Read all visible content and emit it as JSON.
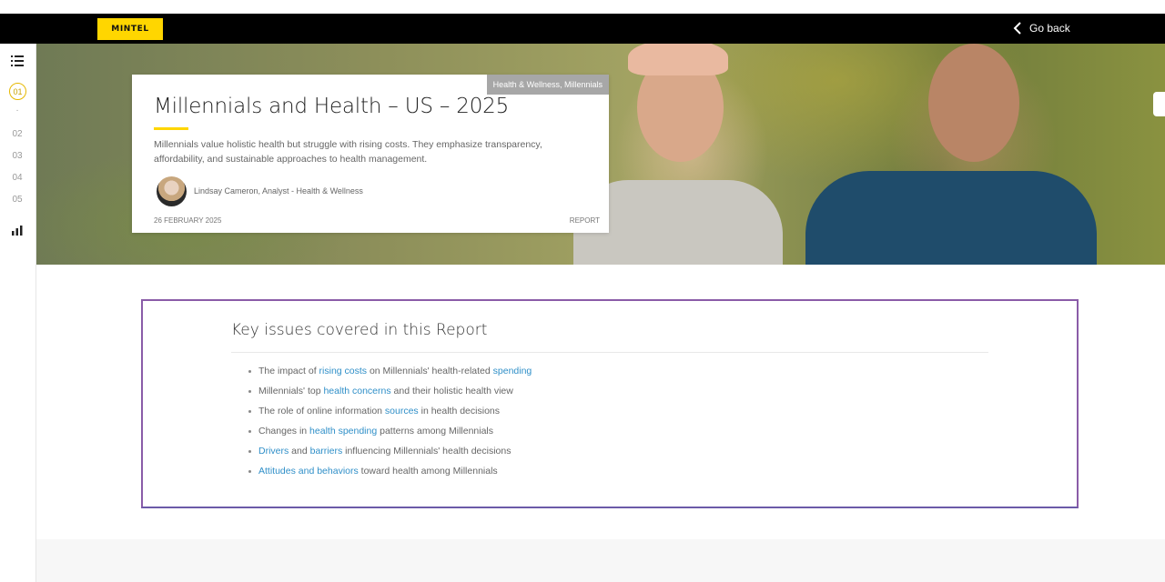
{
  "header": {
    "logo": "MINTEL",
    "go_back": "Go back"
  },
  "sidebar": {
    "active": "01",
    "dot": "·",
    "items": [
      "02",
      "03",
      "04",
      "05"
    ]
  },
  "card": {
    "tag": "Health & Wellness, Millennials",
    "title": "Millennials and Health – US – 2025",
    "description": "Millennials value holistic health but struggle with rising costs. They emphasize transparency, affordability, and sustainable approaches to health management.",
    "author": "Lindsay Cameron, Analyst - Health & Wellness",
    "date": "26 FEBRUARY 2025",
    "type": "REPORT"
  },
  "issues": {
    "heading": "Key issues covered in this Report",
    "items": [
      {
        "a": "The impact of ",
        "b": "rising costs",
        "c": " on Millennials' health-related ",
        "d": "spending",
        "e": ""
      },
      {
        "a": "Millennials' top ",
        "b": "health concerns",
        "c": " and their holistic health view",
        "d": "",
        "e": ""
      },
      {
        "a": "The role of online information ",
        "b": "sources",
        "c": " in health decisions",
        "d": "",
        "e": ""
      },
      {
        "a": "Changes in ",
        "b": "health spending",
        "c": " patterns among Millennials",
        "d": "",
        "e": ""
      },
      {
        "a": "",
        "b": "Drivers",
        "c": " and ",
        "d": "barriers",
        "e": " influencing Millennials' health decisions"
      },
      {
        "a": "",
        "b": "Attitudes and behaviors",
        "c": " toward health among Millennials",
        "d": "",
        "e": ""
      }
    ]
  },
  "colors": {
    "brand_yellow": "#ffd600",
    "link": "#2f8fc8",
    "frame": "#8a5ca8"
  }
}
